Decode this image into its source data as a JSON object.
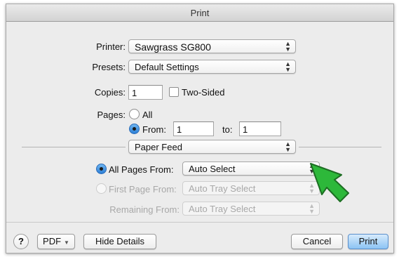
{
  "window": {
    "title": "Print"
  },
  "printer": {
    "label": "Printer:",
    "value": "Sawgrass SG800"
  },
  "presets": {
    "label": "Presets:",
    "value": "Default Settings"
  },
  "copies": {
    "label": "Copies:",
    "value": "1",
    "two_sided_label": "Two-Sided",
    "two_sided_checked": false
  },
  "pages": {
    "label": "Pages:",
    "all_label": "All",
    "from_label": "From:",
    "from_value": "1",
    "to_label": "to:",
    "to_value": "1",
    "selected": "From"
  },
  "section": {
    "value": "Paper Feed"
  },
  "paper_feed": {
    "all_pages_label": "All Pages From:",
    "all_pages_value": "Auto Select",
    "first_page_label": "First Page From:",
    "first_page_value": "Auto Tray Select",
    "remaining_label": "Remaining From:",
    "remaining_value": "Auto Tray Select",
    "selected": "All Pages From"
  },
  "footer": {
    "help_label": "?",
    "pdf_label": "PDF",
    "hide_details_label": "Hide Details",
    "cancel_label": "Cancel",
    "print_label": "Print"
  },
  "icons": {
    "popup_arrows": "up-down-arrows",
    "pointer": "green-arrow-cursor"
  },
  "colors": {
    "accent": "#3d8fd8",
    "pointer": "#2db83a"
  }
}
